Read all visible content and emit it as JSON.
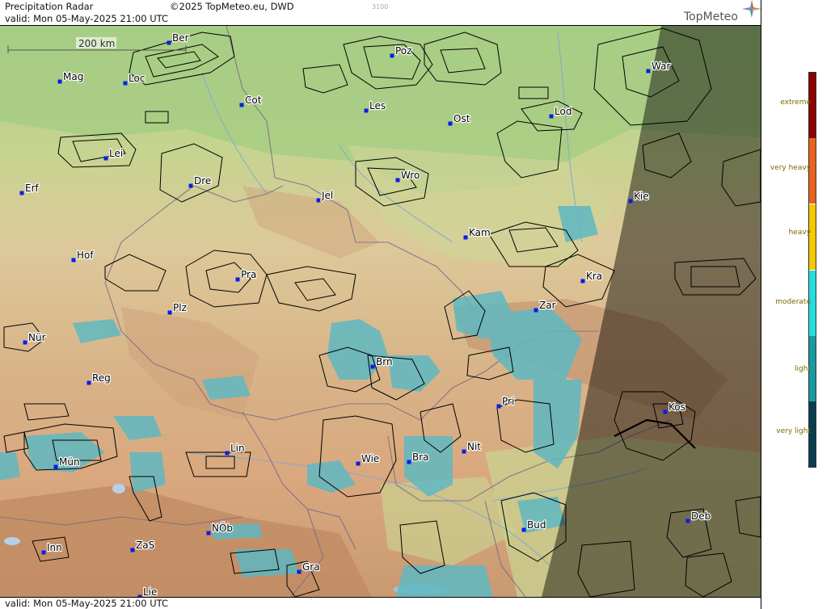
{
  "header": {
    "title": "Precipitation Radar",
    "copyright": "©2025 TopMeteo.eu, DWD",
    "code": "3100",
    "valid": "valid:  Mon  05-May-2025 21:00 UTC",
    "logo": "TopMeteo"
  },
  "footer": {
    "valid": "valid:  Mon  05-May-2025 21:00 UTC"
  },
  "scale_bar": {
    "label": "200 km"
  },
  "legend": {
    "items": [
      {
        "label": "extreme",
        "color": "#8b0000"
      },
      {
        "label": "very heavy",
        "color": "#e8641e"
      },
      {
        "label": "heavy",
        "color": "#f5c800"
      },
      {
        "label": "moderate",
        "color": "#22dede"
      },
      {
        "label": "light",
        "color": "#199aa0"
      },
      {
        "label": "very light",
        "color": "#0b3d50"
      }
    ]
  },
  "cities": [
    {
      "label": "Ber"
    },
    {
      "label": "Poz"
    },
    {
      "label": "War"
    },
    {
      "label": "Mag"
    },
    {
      "label": "Loc"
    },
    {
      "label": "Cot"
    },
    {
      "label": "Les"
    },
    {
      "label": "Ost"
    },
    {
      "label": "Lod"
    },
    {
      "label": "Lei"
    },
    {
      "label": "Wro"
    },
    {
      "label": "Erf"
    },
    {
      "label": "Dre"
    },
    {
      "label": "Jel"
    },
    {
      "label": "Kie"
    },
    {
      "label": "Kam"
    },
    {
      "label": "Hof"
    },
    {
      "label": "Pra"
    },
    {
      "label": "Kra"
    },
    {
      "label": "Plz"
    },
    {
      "label": "Zar"
    },
    {
      "label": "Nür"
    },
    {
      "label": "Brn"
    },
    {
      "label": "Reg"
    },
    {
      "label": "Pri"
    },
    {
      "label": "Kos"
    },
    {
      "label": "Lin"
    },
    {
      "label": "Nit"
    },
    {
      "label": "Mün"
    },
    {
      "label": "Wie"
    },
    {
      "label": "Bra"
    },
    {
      "label": "Bud"
    },
    {
      "label": "Deb"
    },
    {
      "label": "NÖb"
    },
    {
      "label": "Inn"
    },
    {
      "label": "ZaS"
    },
    {
      "label": "Gra"
    },
    {
      "label": "Lie"
    }
  ]
}
